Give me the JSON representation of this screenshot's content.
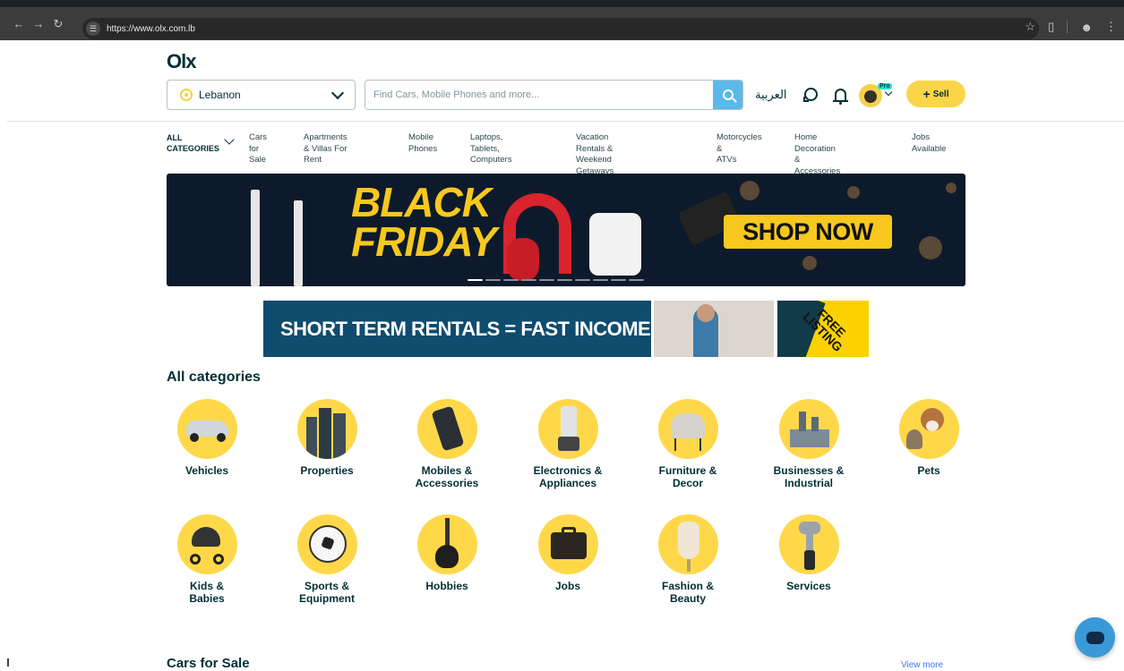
{
  "browser": {
    "url": "https://www.olx.com.lb",
    "nav_icons": [
      "back-arrow-icon",
      "forward-arrow-icon",
      "reload-icon"
    ],
    "right_icons": [
      "star-icon",
      "extensions-icon",
      "profile-icon",
      "menu-icon"
    ]
  },
  "header": {
    "logo": "Olx",
    "location": "Lebanon",
    "search_placeholder": "Find Cars, Mobile Phones and more...",
    "language": "العربية",
    "pro_badge": "Pro",
    "sell_label": "Sell"
  },
  "catnav": {
    "all_categories_line1": "ALL",
    "all_categories_line2": "CATEGORIES",
    "items": [
      {
        "line1": "Cars for",
        "line2": "Sale"
      },
      {
        "line1": "Apartments & Villas For",
        "line2": "Rent"
      },
      {
        "line1": "Mobile",
        "line2": "Phones"
      },
      {
        "line1": "Laptops, Tablets,",
        "line2": "Computers"
      },
      {
        "line1": "Vacation Rentals & Weekend",
        "line2": "Getaways"
      },
      {
        "line1": "Motorcycles &",
        "line2": "ATVs"
      },
      {
        "line1": "Home Decoration &",
        "line2": "Accessories"
      },
      {
        "line1": "Jobs",
        "line2": "Available"
      }
    ]
  },
  "banners": {
    "black_friday_line1": "BLACK",
    "black_friday_line2": "FRIDAY",
    "shop_now": "SHOP NOW",
    "rentals": "SHORT TERM RENTALS = FAST INCOME",
    "free_listing_line1": "FREE",
    "free_listing_line2": "LISTING",
    "carousel_slides": 10,
    "carousel_active": 1
  },
  "all_categories": {
    "title": "All categories",
    "items": [
      {
        "line1": "Vehicles",
        "line2": "",
        "icon": "car-icon"
      },
      {
        "line1": "Properties",
        "line2": "",
        "icon": "buildings-icon"
      },
      {
        "line1": "Mobiles &",
        "line2": "Accessories",
        "icon": "phone-icon"
      },
      {
        "line1": "Electronics &",
        "line2": "Appliances",
        "icon": "blender-icon"
      },
      {
        "line1": "Furniture &",
        "line2": "Decor",
        "icon": "armchair-icon"
      },
      {
        "line1": "Businesses &",
        "line2": "Industrial",
        "icon": "factory-icon"
      },
      {
        "line1": "Pets",
        "line2": "",
        "icon": "pets-icon"
      },
      {
        "line1": "Kids &",
        "line2": "Babies",
        "icon": "stroller-icon"
      },
      {
        "line1": "Sports &",
        "line2": "Equipment",
        "icon": "soccer-ball-icon"
      },
      {
        "line1": "Hobbies",
        "line2": "",
        "icon": "guitar-icon"
      },
      {
        "line1": "Jobs",
        "line2": "",
        "icon": "briefcase-icon"
      },
      {
        "line1": "Fashion &",
        "line2": "Beauty",
        "icon": "mannequin-icon"
      },
      {
        "line1": "Services",
        "line2": "",
        "icon": "wrench-icon"
      }
    ]
  },
  "cars_section": {
    "title": "Cars for Sale",
    "view_more": "View more"
  },
  "colors": {
    "brand_dark": "#002f34",
    "accent_yellow": "#ffd84a",
    "search_blue": "#5ab9ea",
    "sell_yellow": "#fbd548"
  }
}
